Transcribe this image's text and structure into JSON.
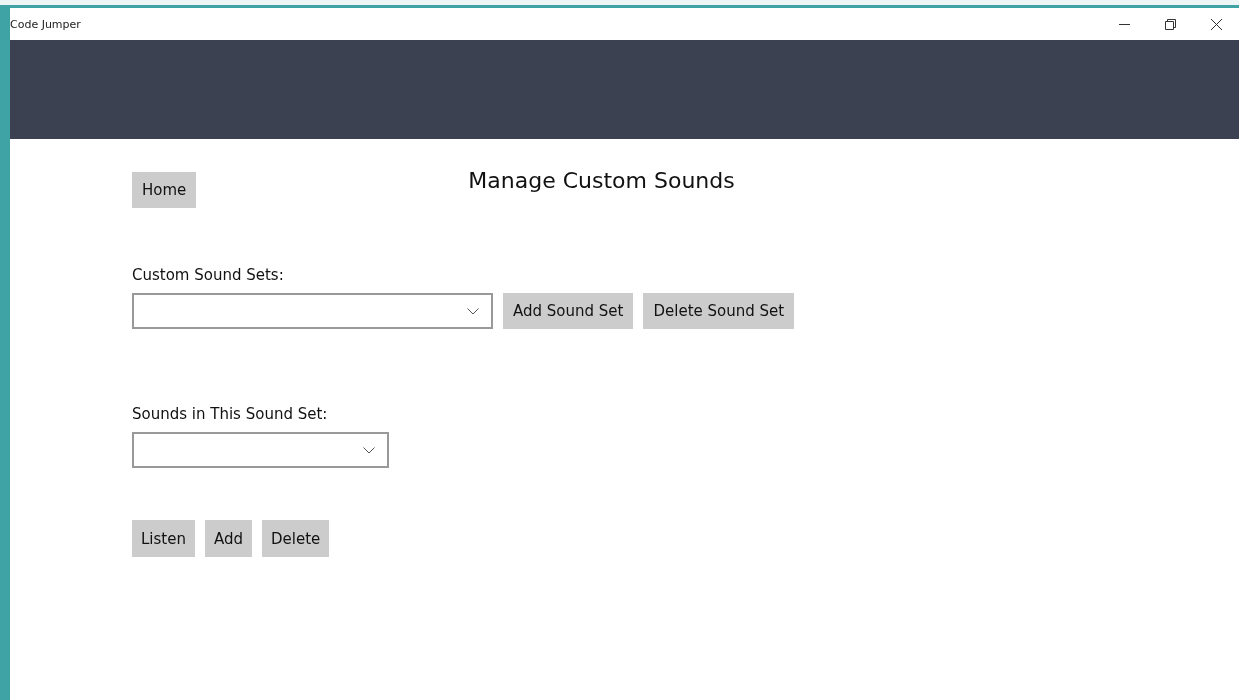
{
  "window": {
    "title": "Code Jumper",
    "controls": [
      {
        "kind": "minimize"
      },
      {
        "kind": "restore"
      },
      {
        "kind": "close"
      }
    ]
  },
  "page": {
    "home_button": "Home",
    "title": "Manage Custom Sounds"
  },
  "sound_sets": {
    "label": "Custom Sound Sets:",
    "buttons": [
      "Add Sound Set",
      "Delete Sound Set"
    ]
  },
  "sounds": {
    "label": "Sounds in This Sound Set:",
    "buttons": [
      "Listen",
      "Add",
      "Delete"
    ]
  }
}
